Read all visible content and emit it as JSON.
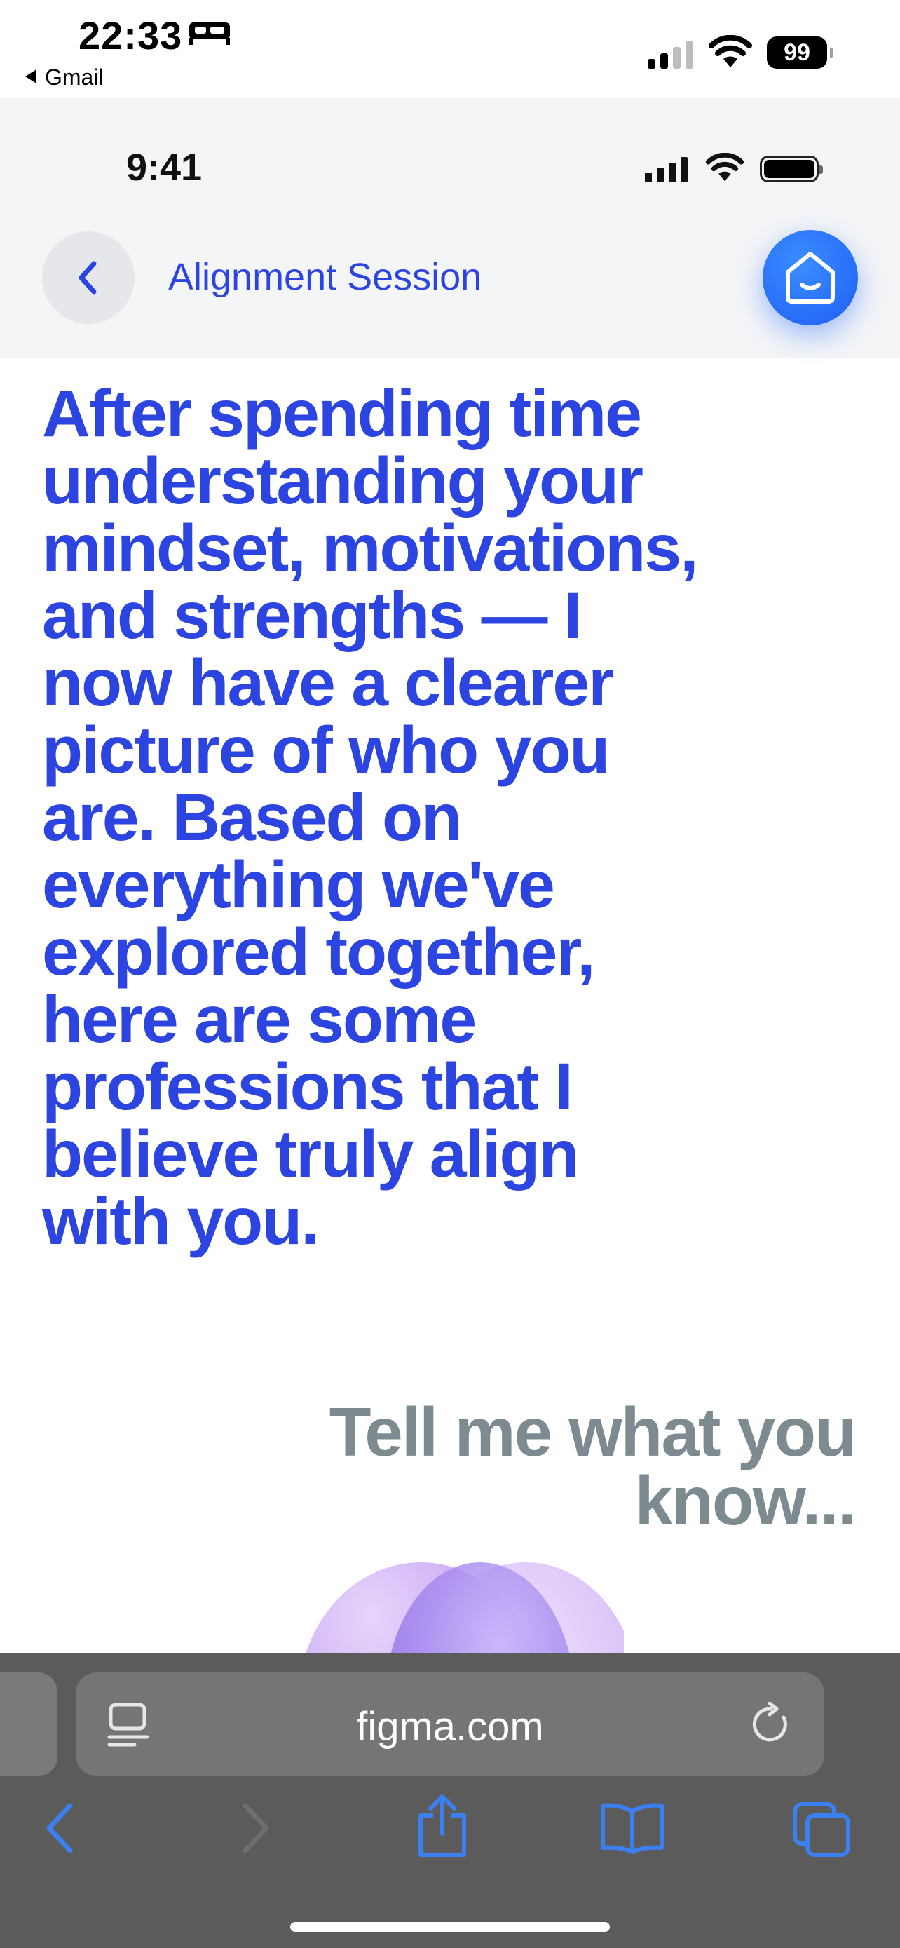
{
  "os_status": {
    "time": "22:33",
    "back_app": "Gmail",
    "battery": "99"
  },
  "app_status": {
    "time": "9:41"
  },
  "header": {
    "title": "Alignment Session"
  },
  "message": {
    "text": "After spending time understanding your mindset, motivations, and strengths — I now have a clearer picture of who you are. Based on everything we've explored together, here are some professions that I believe truly align with you."
  },
  "reply_prompt": {
    "text": "Tell me what you know..."
  },
  "browser": {
    "url": "figma.com"
  },
  "colors": {
    "accent": "#2c44e0",
    "muted": "#7d8b91",
    "home_button": "#1e5ef5"
  }
}
